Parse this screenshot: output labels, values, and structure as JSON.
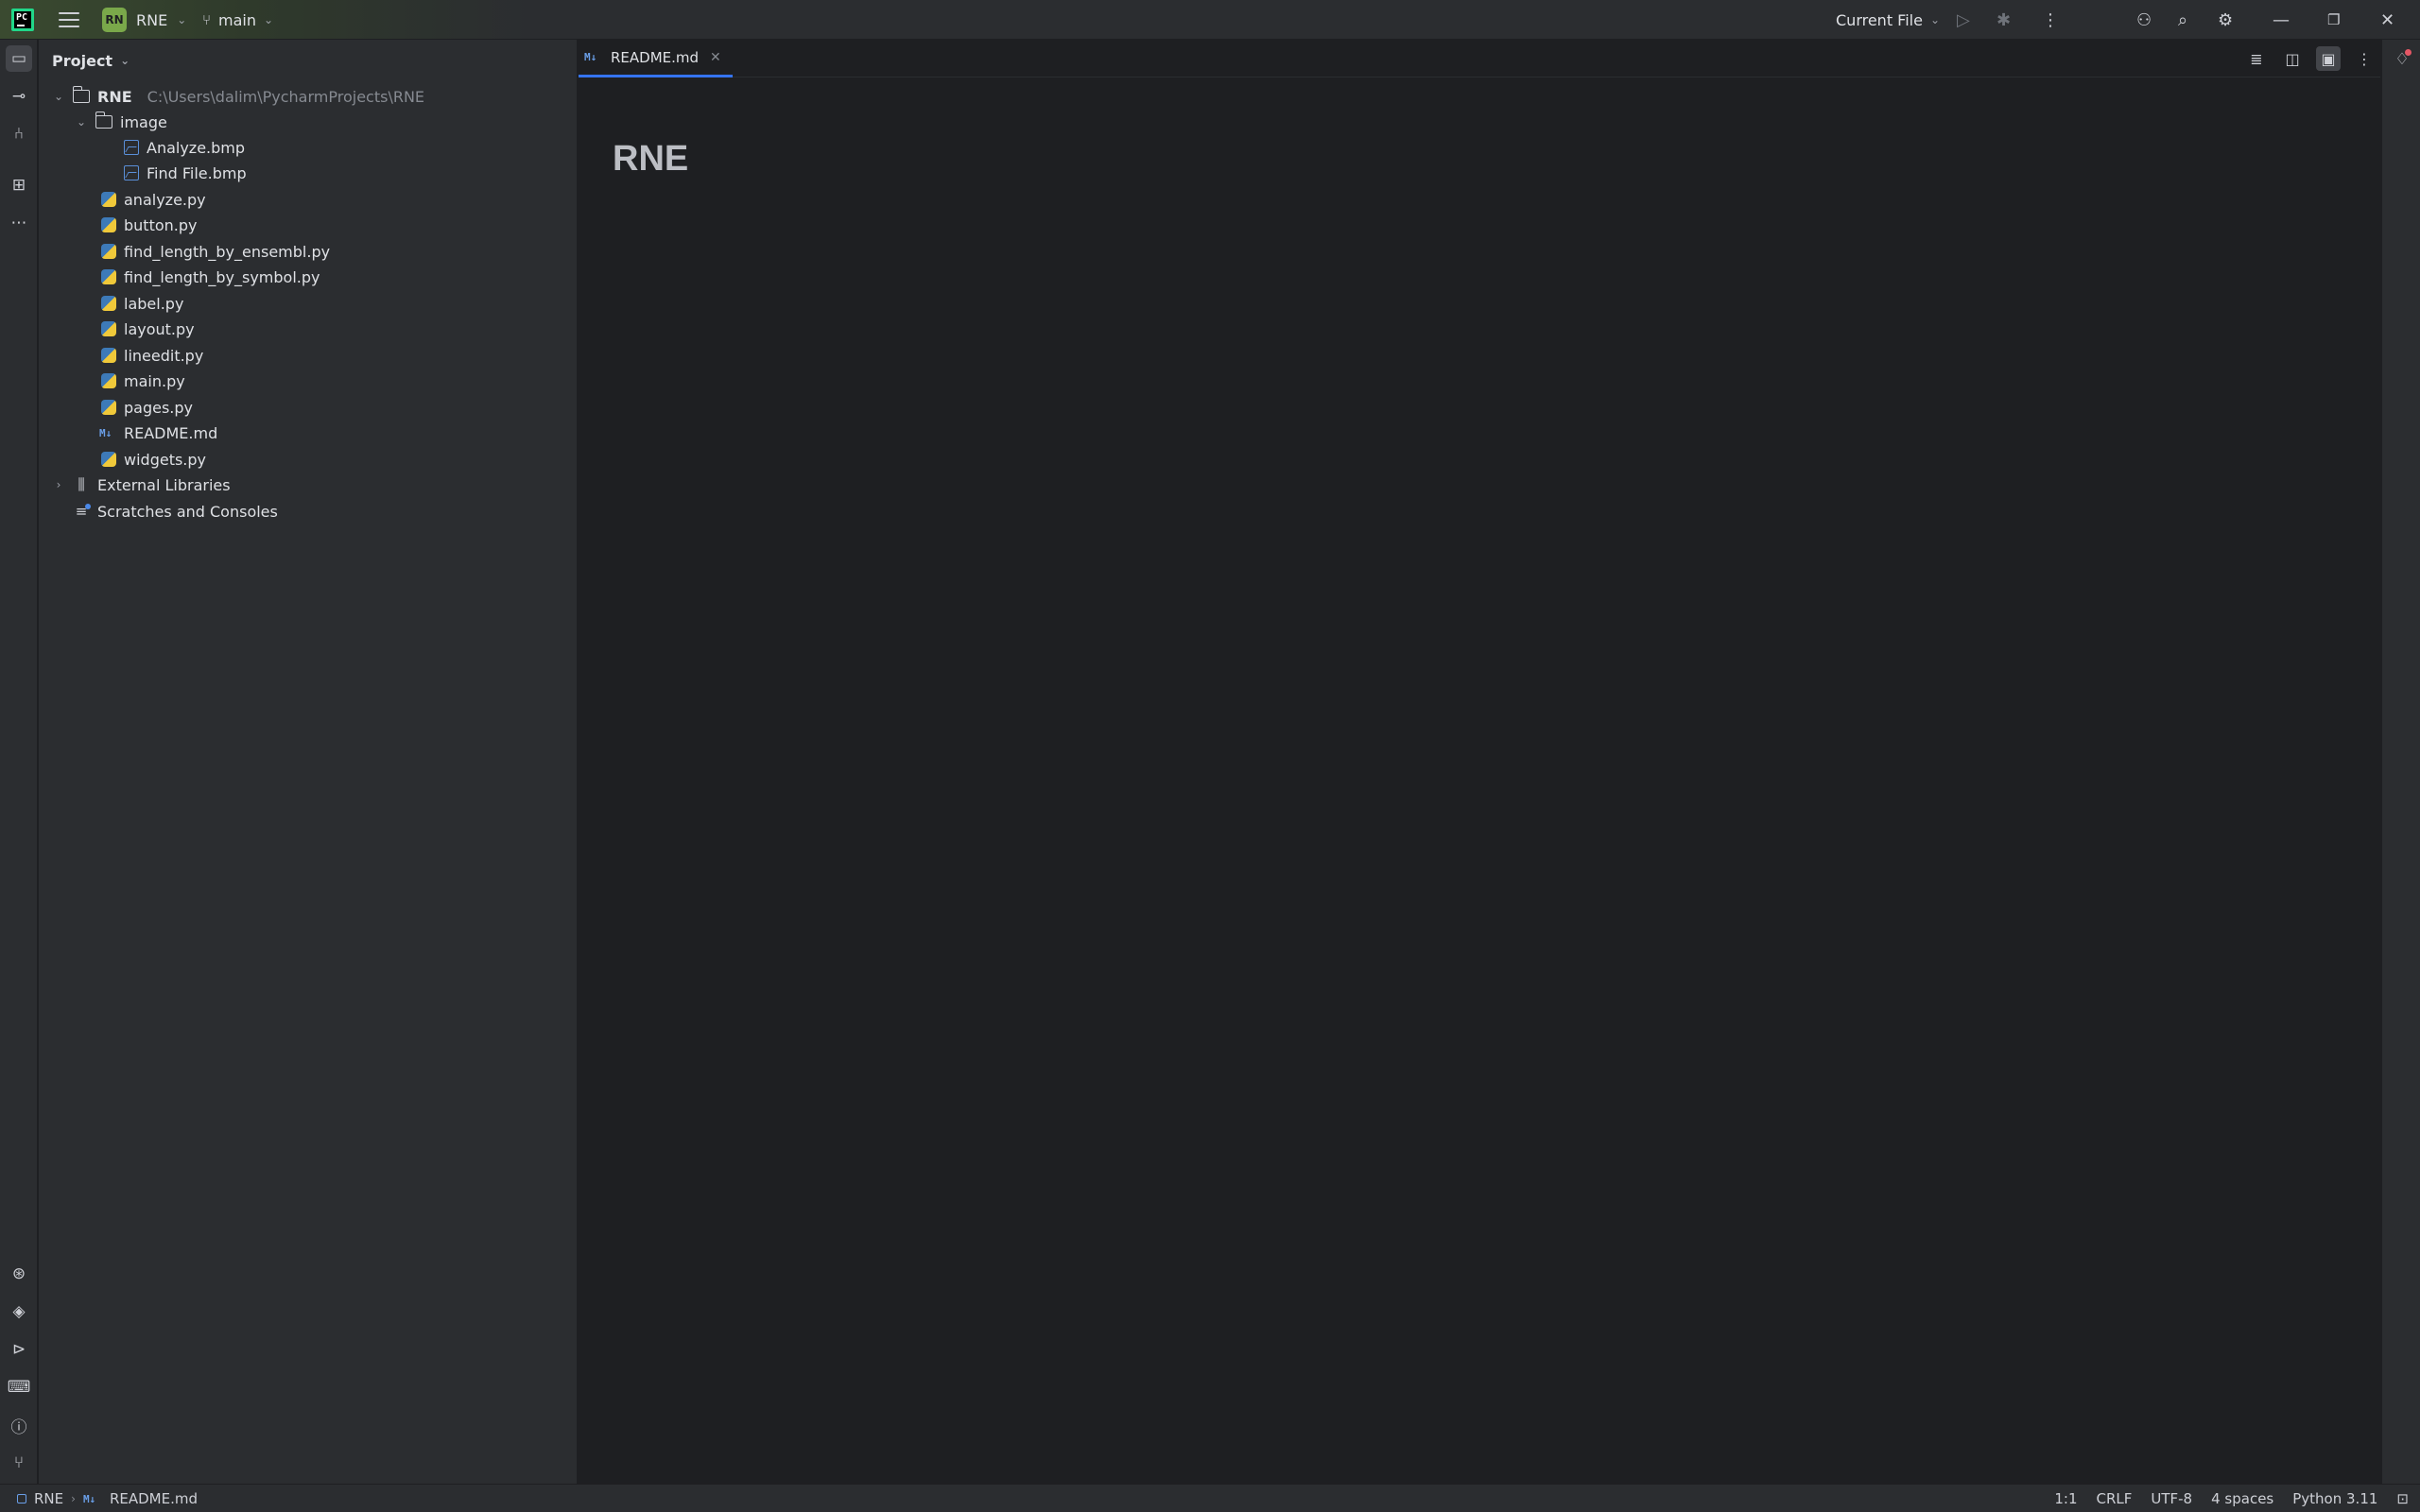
{
  "titlebar": {
    "project_badge": "RN",
    "project_name": "RNE",
    "branch": "main",
    "run_config": "Current File"
  },
  "project_panel": {
    "title": "Project",
    "root": {
      "name": "RNE",
      "path": "C:\\Users\\dalim\\PycharmProjects\\RNE"
    },
    "image_folder": "image",
    "image_files": [
      "Analyze.bmp",
      "Find File.bmp"
    ],
    "files": [
      {
        "name": "analyze.py",
        "type": "py"
      },
      {
        "name": "button.py",
        "type": "py"
      },
      {
        "name": "find_length_by_ensembl.py",
        "type": "py"
      },
      {
        "name": "find_length_by_symbol.py",
        "type": "py"
      },
      {
        "name": "label.py",
        "type": "py"
      },
      {
        "name": "layout.py",
        "type": "py"
      },
      {
        "name": "lineedit.py",
        "type": "py"
      },
      {
        "name": "main.py",
        "type": "py"
      },
      {
        "name": "pages.py",
        "type": "py"
      },
      {
        "name": "README.md",
        "type": "md"
      },
      {
        "name": "widgets.py",
        "type": "py"
      }
    ],
    "external_libraries": "External Libraries",
    "scratches": "Scratches and Consoles"
  },
  "editor": {
    "tab_label": "README.md",
    "md_badge": "M↓",
    "preview_heading": "RNE"
  },
  "statusbar": {
    "project": "RNE",
    "file": "README.md",
    "position": "1:1",
    "line_sep": "CRLF",
    "encoding": "UTF-8",
    "indent": "4 spaces",
    "interpreter": "Python 3.11"
  }
}
